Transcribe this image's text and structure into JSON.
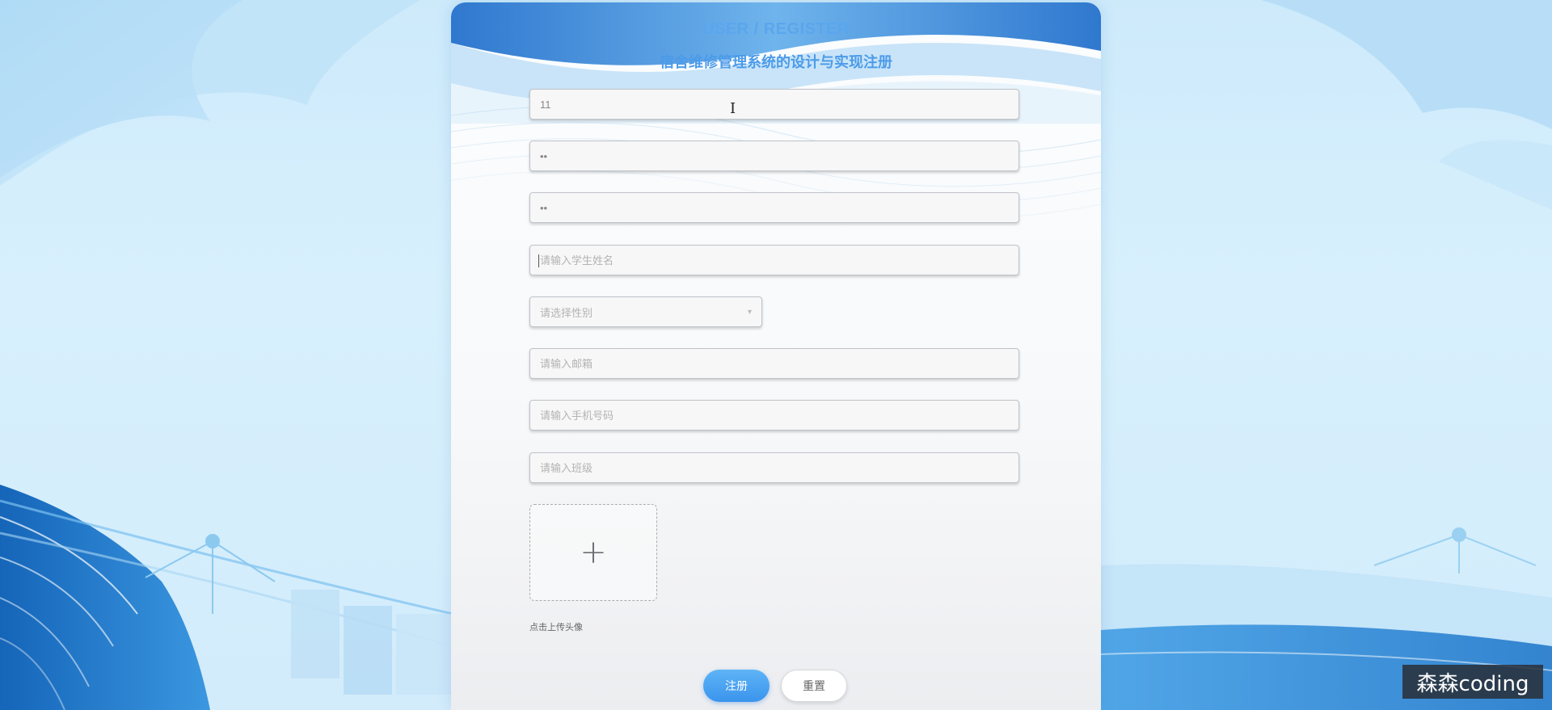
{
  "header": {
    "title": "USER / REGISTER",
    "subtitle": "宿舍维修管理系统的设计与实现注册"
  },
  "form": {
    "account": {
      "value": "11",
      "placeholder": ""
    },
    "password": {
      "value": "••",
      "placeholder": ""
    },
    "confirm_password": {
      "value": "••",
      "placeholder": ""
    },
    "student_name": {
      "value": "",
      "placeholder": "请输入学生姓名"
    },
    "gender": {
      "selected": "请选择性别",
      "arrow_icon": "chevron-down-icon"
    },
    "email": {
      "value": "",
      "placeholder": "请输入邮箱"
    },
    "phone": {
      "value": "",
      "placeholder": "请输入手机号码"
    },
    "class_name": {
      "value": "",
      "placeholder": "请输入班级"
    },
    "avatar_upload": {
      "icon": "plus-icon",
      "plus_glyph": "+",
      "label": "点击上传头像"
    }
  },
  "buttons": {
    "register_label": "注册",
    "reset_label": "重置"
  },
  "watermark": {
    "text": "森森coding"
  },
  "colors": {
    "accent": "#3a94ec",
    "title": "#5aa6ee",
    "background": "#d2ecfb",
    "dark_blue": "#1f76c8"
  }
}
